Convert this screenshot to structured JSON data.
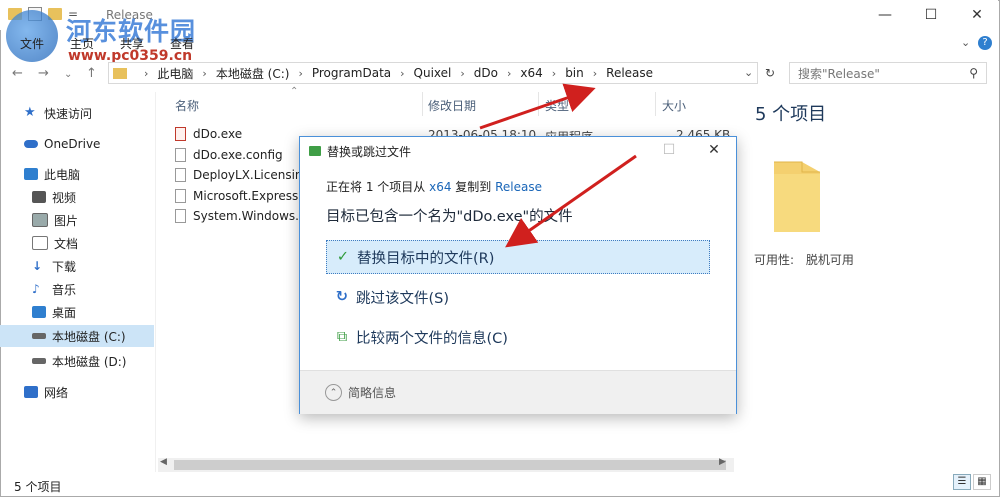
{
  "window": {
    "title": "Release",
    "controls": {
      "minimize": "—",
      "maximize": "☐",
      "close": "✕"
    }
  },
  "watermark": {
    "line1": "河东软件园",
    "line2": "www.pc0359.cn"
  },
  "ribbon": {
    "tabs": [
      "文件",
      "主页",
      "共享",
      "查看"
    ]
  },
  "address": {
    "crumbs": [
      "此电脑",
      "本地磁盘 (C:)",
      "ProgramData",
      "Quixel",
      "dDo",
      "x64",
      "bin",
      "Release"
    ],
    "search_placeholder": "搜索\"Release\""
  },
  "nav": {
    "items": [
      {
        "label": "快速访问",
        "icon": "star-icon",
        "color": "#2f6fc9"
      },
      {
        "label": "OneDrive",
        "icon": "cloud-icon",
        "color": "#2f6fc9"
      },
      {
        "label": "此电脑",
        "icon": "computer-icon",
        "color": "#2f7fcf"
      },
      {
        "label": "视频",
        "icon": "video-icon",
        "color": "#444"
      },
      {
        "label": "图片",
        "icon": "picture-icon",
        "color": "#444"
      },
      {
        "label": "文档",
        "icon": "document-icon",
        "color": "#777"
      },
      {
        "label": "下载",
        "icon": "download-icon",
        "color": "#2f6fc9"
      },
      {
        "label": "音乐",
        "icon": "music-icon",
        "color": "#2f6fc9"
      },
      {
        "label": "桌面",
        "icon": "desktop-icon",
        "color": "#2f7fcf"
      },
      {
        "label": "本地磁盘 (C:)",
        "icon": "drive-icon",
        "color": "#555"
      },
      {
        "label": "本地磁盘 (D:)",
        "icon": "drive-icon",
        "color": "#555"
      },
      {
        "label": "网络",
        "icon": "network-icon",
        "color": "#2f6fc9"
      }
    ]
  },
  "list": {
    "headers": {
      "name": "名称",
      "modified": "修改日期",
      "type": "类型",
      "size": "大小"
    },
    "files": [
      "dDo.exe",
      "dDo.exe.config",
      "DeployLX.Licensing",
      "Microsoft.Expressi",
      "System.Windows.In"
    ],
    "first_row": {
      "modified": "2013-06-05 18:10",
      "type": "应用程序",
      "size": "2,465 KB"
    }
  },
  "details": {
    "count": "5 个项目",
    "availability_label": "可用性:",
    "availability_value": "脱机可用"
  },
  "status": {
    "count": "5 个项目"
  },
  "dialog": {
    "title": "替换或跳过文件",
    "line1_prefix": "正在将 1 个项目从 ",
    "line1_src": "x64",
    "line1_mid": " 复制到 ",
    "line1_dst": "Release",
    "line2": "目标已包含一个名为\"dDo.exe\"的文件",
    "options": [
      {
        "label": "替换目标中的文件(R)",
        "icon": "check-icon"
      },
      {
        "label": "跳过该文件(S)",
        "icon": "skip-icon"
      },
      {
        "label": "比较两个文件的信息(C)",
        "icon": "compare-icon"
      }
    ],
    "more": "简略信息"
  },
  "colors": {
    "accent": "#3f7cc0",
    "arrow": "#d0201e",
    "selection": "#cce4f7"
  }
}
